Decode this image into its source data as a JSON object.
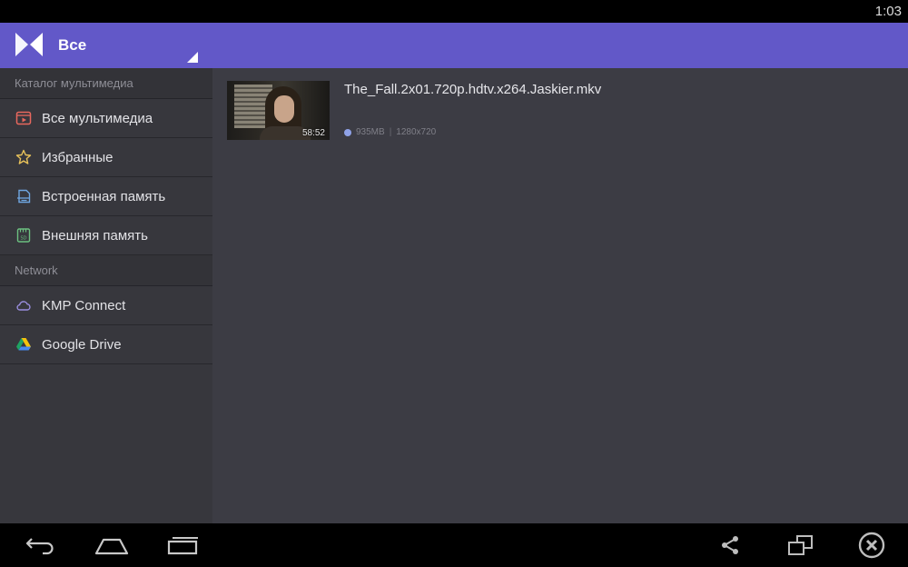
{
  "status_bar": {
    "time": "1:03"
  },
  "app_bar": {
    "logo_icon": "kmplayer-logo-icon",
    "title": "Все",
    "dropdown_icon": "dropdown-triangle-icon",
    "color": "#6258c8"
  },
  "sidebar": {
    "sections": [
      {
        "header": "Каталог мультимедиа",
        "items": [
          {
            "label": "Все мультимедиа",
            "icon": "media-library-icon"
          },
          {
            "label": "Избранные",
            "icon": "star-icon"
          },
          {
            "label": "Встроенная память",
            "icon": "internal-storage-icon"
          },
          {
            "label": "Внешняя память",
            "icon": "sd-card-icon"
          }
        ]
      },
      {
        "header": "Network",
        "items": [
          {
            "label": "KMP Connect",
            "icon": "cloud-icon"
          },
          {
            "label": "Google Drive",
            "icon": "google-drive-icon"
          }
        ]
      }
    ]
  },
  "videos": [
    {
      "title": "The_Fall.2x01.720p.hdtv.x264.Jaskier.mkv",
      "duration": "58:52",
      "size": "935MB",
      "resolution": "1280x720"
    }
  ],
  "nav_bar": {
    "left": [
      "back-icon",
      "home-icon",
      "recents-icon"
    ],
    "right": [
      "share-icon",
      "window-resize-icon",
      "close-circle-icon"
    ]
  }
}
